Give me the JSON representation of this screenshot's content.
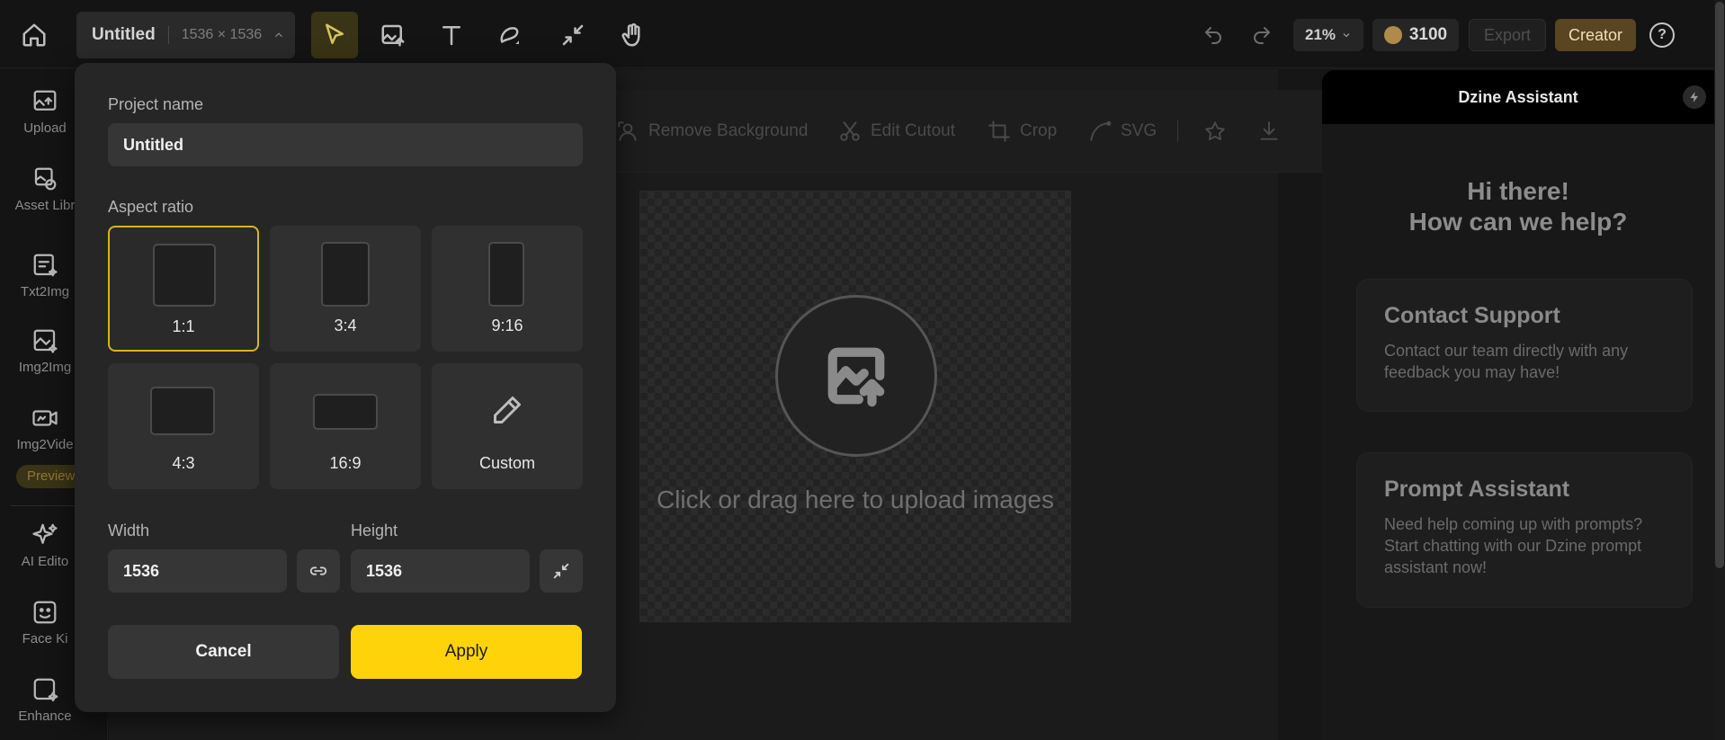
{
  "topbar": {
    "project_name": "Untitled",
    "project_dims": "1536 × 1536",
    "zoom": "21%",
    "credits": "3100",
    "export_label": "Export",
    "creator_label": "Creator",
    "help_label": "?"
  },
  "sidebar": {
    "items": [
      {
        "label": "Upload",
        "icon": "upload-image-icon"
      },
      {
        "label": "Asset Libr",
        "icon": "asset-library-icon"
      },
      {
        "label": "Txt2Img",
        "icon": "txt2img-icon"
      },
      {
        "label": "Img2Img",
        "icon": "img2img-icon"
      },
      {
        "label": "Img2Vide",
        "icon": "img2video-icon"
      },
      {
        "label": "AI Edito",
        "icon": "sparkle-icon"
      },
      {
        "label": "Face Ki",
        "icon": "face-icon"
      },
      {
        "label": "Enhance",
        "icon": "enhance-icon"
      }
    ],
    "preview_badge": "Preview"
  },
  "canvas_toolbar": {
    "remove_bg": "Remove Background",
    "edit_cutout": "Edit Cutout",
    "crop": "Crop",
    "svg": "SVG"
  },
  "canvas": {
    "upload_text": "Click or drag here to upload images"
  },
  "assistant": {
    "title": "Dzine Assistant",
    "greeting_line1": "Hi there!",
    "greeting_line2": "How can we help?",
    "cards": [
      {
        "title": "Contact Support",
        "desc": "Contact our team directly with any feedback you may have!"
      },
      {
        "title": "Prompt Assistant",
        "desc": "Need help coming up with prompts? Start chatting with our Dzine prompt assistant now!"
      }
    ]
  },
  "modal": {
    "project_name_label": "Project name",
    "project_name_value": "Untitled",
    "aspect_ratio_label": "Aspect ratio",
    "ratios": [
      "1:1",
      "3:4",
      "9:16",
      "4:3",
      "16:9",
      "Custom"
    ],
    "selected_ratio": "1:1",
    "width_label": "Width",
    "height_label": "Height",
    "width_value": "1536",
    "height_value": "1536",
    "cancel_label": "Cancel",
    "apply_label": "Apply"
  },
  "colors": {
    "accent": "#ffd30a",
    "selected_border": "#d6b51e",
    "creator_bg": "#5a4522",
    "coin": "#b08a4a"
  }
}
